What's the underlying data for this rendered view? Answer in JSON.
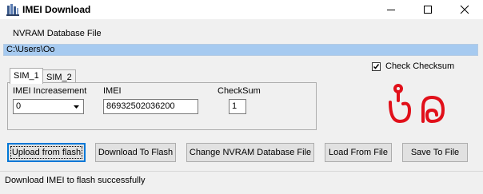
{
  "window": {
    "title": "IMEI Download"
  },
  "nvram": {
    "label": "NVRAM Database File",
    "path": "C:\\Users\\Oo"
  },
  "check_checksum": {
    "label": "Check Checksum",
    "checked": true
  },
  "tabs": [
    {
      "label": "SIM_1",
      "active": true
    },
    {
      "label": "SIM_2",
      "active": false
    }
  ],
  "sim": {
    "imei_increasement_label": "IMEI Increasement",
    "imei_increasement_value": "0",
    "imei_label": "IMEI",
    "imei_value": "86932502036200",
    "checksum_label": "CheckSum",
    "checksum_value": "1"
  },
  "buttons": {
    "upload": "Upload from flash",
    "download": "Download To Flash",
    "change": "Change NVRAM Database File",
    "load": "Load From File",
    "save": "Save To File"
  },
  "status": {
    "text": "Download IMEI to flash successfully"
  },
  "colors": {
    "path_highlight": "#a6caf0",
    "logo_red": "#e1101a",
    "focus_blue": "#0078d7"
  }
}
